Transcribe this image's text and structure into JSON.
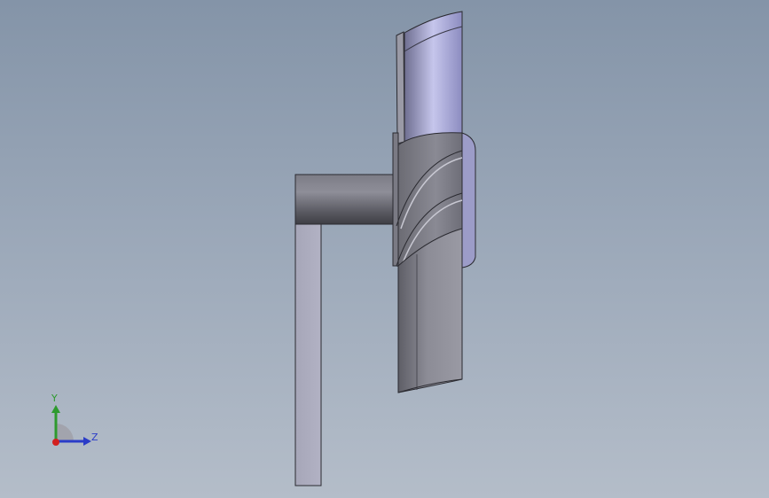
{
  "viewport": {
    "background_top": "#8494a8",
    "background_bottom": "#b4bdc9"
  },
  "triad": {
    "y_label": "Y",
    "z_label": "Z",
    "y_color": "#2e9a2e",
    "z_color": "#2a3cc8",
    "x_color": "#d22020"
  }
}
